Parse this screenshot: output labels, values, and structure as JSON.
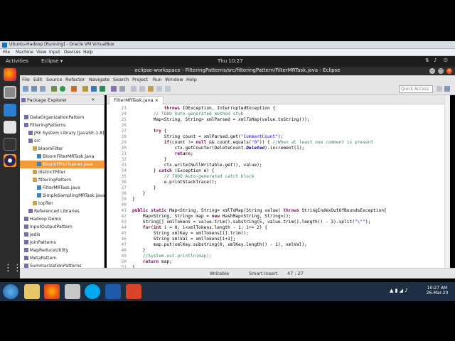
{
  "vbox": {
    "title": "Ubuntu-Hadoop [Running] - Oracle VM VirtualBox",
    "menu": [
      "File",
      "Machine",
      "View",
      "Input",
      "Devices",
      "Help"
    ]
  },
  "ubuntu": {
    "activities": "Activities",
    "app": "Eclipse ▾",
    "clock": "Thu 10:27"
  },
  "eclipse": {
    "title": "eclipse-workspace - FilteringPatterns/src/filteringPattern/FilterMRTask.java - Eclipse",
    "menu": [
      "File",
      "Edit",
      "Source",
      "Refactor",
      "Navigate",
      "Search",
      "Project",
      "Run",
      "Window",
      "Help"
    ],
    "quick_access": "Quick Access",
    "package_explorer_title": "Package Explorer",
    "tree": [
      {
        "label": "DataOrganizationPattern",
        "indent": 1
      },
      {
        "label": "FilteringPatterns",
        "indent": 1
      },
      {
        "label": "JRE System Library [JavaSE-1.8]",
        "indent": 2
      },
      {
        "label": "src",
        "indent": 2
      },
      {
        "label": "bloomFilter",
        "indent": 3
      },
      {
        "label": "BloomFilterMRTask.java",
        "indent": 4
      },
      {
        "label": "BloomFilterTrainer.java",
        "indent": 4,
        "selected": true
      },
      {
        "label": "distinctFilter",
        "indent": 3
      },
      {
        "label": "filteringPattern",
        "indent": 3
      },
      {
        "label": "FilterMRTask.java",
        "indent": 4
      },
      {
        "label": "SimpleSamplingMRTask.java",
        "indent": 4
      },
      {
        "label": "topTen",
        "indent": 3
      },
      {
        "label": "Referenced Libraries",
        "indent": 2
      },
      {
        "label": "Hadoop Demo",
        "indent": 1
      },
      {
        "label": "InputOutputPattern",
        "indent": 1
      },
      {
        "label": "Jedis",
        "indent": 1
      },
      {
        "label": "JoinPatterns",
        "indent": 1
      },
      {
        "label": "MapReduceUtility",
        "indent": 1
      },
      {
        "label": "MetaPattern",
        "indent": 1
      },
      {
        "label": "SummarizationPatterns",
        "indent": 1
      }
    ],
    "editor_tab": "FilterMRTask.java",
    "code_lines": [
      {
        "n": "23",
        "html": "            <span class='kw'>throws</span> IOException, InterruptedException {"
      },
      {
        "n": "24",
        "html": "        <span class='cm'>// TODO Auto-generated method stub</span>"
      },
      {
        "n": "25",
        "html": "        Map&lt;String, String&gt; xmlParsed = <i>xmlToMap</i>(value.toString());"
      },
      {
        "n": "26",
        "html": ""
      },
      {
        "n": "27",
        "html": "        <span class='kw'>try</span> {"
      },
      {
        "n": "28",
        "html": "            String count = xmlParsed.get(<span class='st'>\"CommentCount\"</span>);"
      },
      {
        "n": "29",
        "html": "            <span class='kw'>if</span>(count != <span class='kw'>null</span> &amp;&amp; count.equals(<span class='st'>\"0\"</span>)) { <span class='cm'>//When at least one comment is present</span>"
      },
      {
        "n": "30",
        "html": "                ctx.getCounter(DeleteCount.<span class='fld'><b><i>Deleted</i></b></span>).increment(1);"
      },
      {
        "n": "31",
        "html": "                <span class='kw'>return</span>;"
      },
      {
        "n": "32",
        "html": "            }"
      },
      {
        "n": "33",
        "html": "            ctx.write(NullWritable.<i>get</i>(), value);"
      },
      {
        "n": "34",
        "html": "        } <span class='kw'>catch</span> (Exception e) {"
      },
      {
        "n": "35",
        "html": "            <span class='cm'>// TODO Auto-generated catch block</span>"
      },
      {
        "n": "36",
        "html": "            e.printStackTrace();"
      },
      {
        "n": "37",
        "html": "        }"
      },
      {
        "n": "38",
        "html": "    }"
      },
      {
        "n": "39",
        "html": "}"
      },
      {
        "n": "40",
        "html": ""
      },
      {
        "n": "41",
        "html": "<span class='kw'>public static</span> Map&lt;String, String&gt; xmlToMap(String value) <span class='kw'>throws</span> StringIndexOutOfBoundsException{"
      },
      {
        "n": "42",
        "html": "    Map&lt;String, String&gt; map = <span class='kw'>new</span> HashMap&lt;String, String&gt;();"
      },
      {
        "n": "43",
        "html": "    String[] xmlTokens = value.trim().substring(5, value.trim().length() - 3).split(<span class='st'>\"\\\"\"</span>);"
      },
      {
        "n": "44",
        "html": "    <span class='kw'>for</span>(<span class='kw'>int</span> i = 0; i&lt;xmlTokens.length - 1; i+= 2) {"
      },
      {
        "n": "45",
        "html": "        String xmlKey = xmlTokens[i].trim();"
      },
      {
        "n": "46",
        "html": "        String xmlVal = xmlTokens[i+1];"
      },
      {
        "n": "47",
        "html": "        map.put(xmlKey.substring(0, xmlKey.length() - 1), xmlVal);"
      },
      {
        "n": "48",
        "html": "    }"
      },
      {
        "n": "49",
        "html": "    <span class='cm'>//System.out.println(map);</span>"
      },
      {
        "n": "50",
        "html": "    <span class='kw'>return</span> map;"
      },
      {
        "n": "51",
        "html": "}"
      }
    ],
    "status": {
      "writable": "Writable",
      "insert": "Smart Insert",
      "pos": "47 : 27"
    }
  },
  "windows": {
    "clock_time": "10:27 AM",
    "clock_date": "26-Mar-20"
  }
}
